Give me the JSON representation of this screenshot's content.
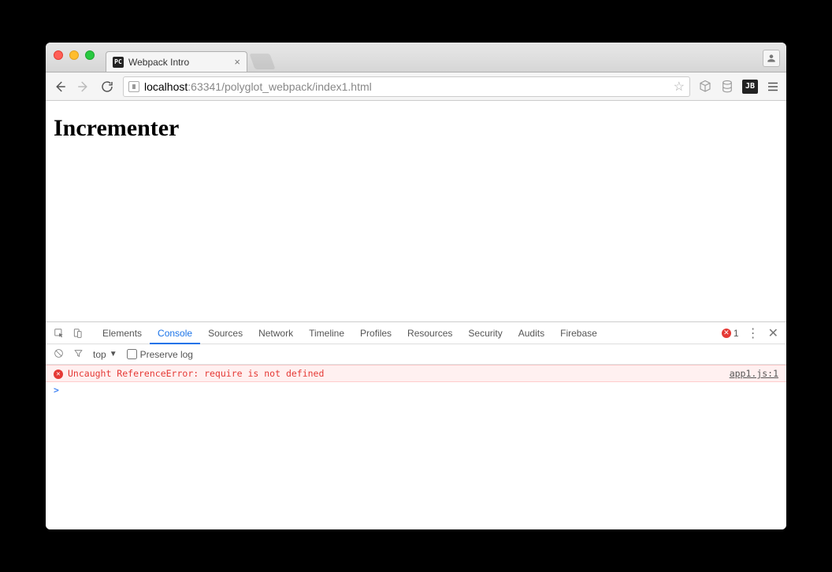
{
  "window": {
    "tab_favicon_text": "PC",
    "tab_title": "Webpack Intro"
  },
  "toolbar": {
    "url_host": "localhost",
    "url_port_path": ":63341/polyglot_webpack/index1.html",
    "jb_label": "JB"
  },
  "page": {
    "heading": "Incrementer"
  },
  "devtools": {
    "tabs": [
      "Elements",
      "Console",
      "Sources",
      "Network",
      "Timeline",
      "Profiles",
      "Resources",
      "Security",
      "Audits",
      "Firebase"
    ],
    "active_tab_index": 1,
    "error_count": "1",
    "toolbar": {
      "context": "top",
      "preserve_log_label": "Preserve log",
      "preserve_log_checked": false
    },
    "console": {
      "error_message": "Uncaught ReferenceError: require is not defined",
      "error_source": "app1.js:1",
      "prompt_symbol": ">"
    }
  }
}
